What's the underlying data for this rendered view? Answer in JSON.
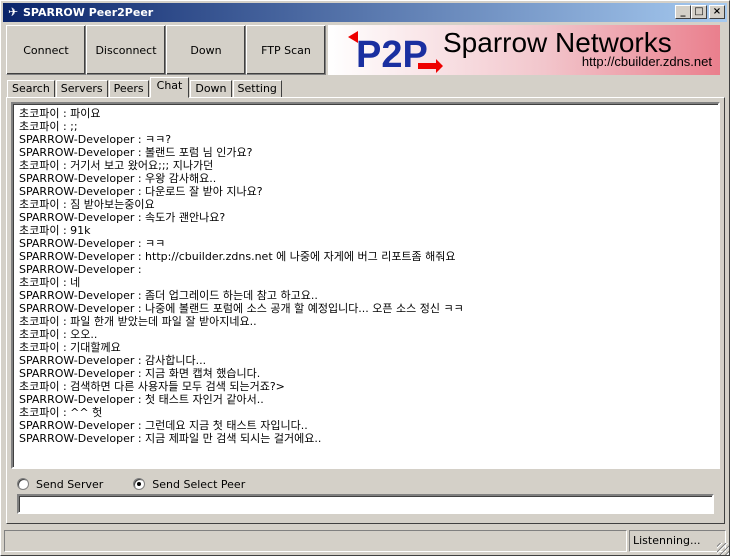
{
  "window": {
    "title": "SPARROW Peer2Peer",
    "min_label": "_",
    "max_label": "□",
    "close_label": "×"
  },
  "toolbar": {
    "connect": "Connect",
    "disconnect": "Disconnect",
    "down": "Down",
    "ftp_scan": "FTP Scan"
  },
  "banner": {
    "logo_text": "P2P",
    "title": "Sparrow Networks",
    "url": "http://cbuilder.zdns.net"
  },
  "tabs": [
    "Search",
    "Servers",
    "Peers",
    "Chat",
    "Down",
    "Setting"
  ],
  "active_tab": "Chat",
  "chat": [
    "초코파이 : 파이요",
    "초코파이 : ;;",
    "SPARROW-Developer : ㅋㅋ?",
    "SPARROW-Developer : 볼랜드 포럼 님 인가요?",
    "초코파이 : 거기서 보고 왔어요;;; 지나가던",
    "SPARROW-Developer : 우왕 감사해요..",
    "SPARROW-Developer : 다운로드 잘 받아 지나요?",
    "초코파이 : 짐 받아보는중이요",
    "SPARROW-Developer : 속도가 괜안나요?",
    "초코파이 : 91k",
    "SPARROW-Developer : ㅋㅋ",
    "SPARROW-Developer : http://cbuilder.zdns.net 에 나중에 자게에 버그 리포트좀 해줘요",
    "SPARROW-Developer :",
    "초코파이 : 네",
    "SPARROW-Developer : 좀더 업그레이드 하는데 참고 하고요..",
    "SPARROW-Developer : 나중에 볼랜드 포럼에 소스 공개 할 예정입니다... 오픈 소스 정신 ㅋㅋ",
    "초코파이 : 파일 한개 받았는데 파일 잘 받아지네요..",
    "초코파이 : 오오..",
    "초코파이 : 기대할께요",
    "SPARROW-Developer : 감사합니다...",
    "SPARROW-Developer : 지금 화면 캡쳐 했습니다.",
    "초코파이 : 검색하면 다른 사용자들 모두 검색 되는거죠?>",
    "SPARROW-Developer : 첫 태스트 자인거 같아서..",
    "초코파이 : ^^ 헛",
    "SPARROW-Developer : 그런데요 지금 첫 태스트 자입니다..",
    "SPARROW-Developer : 지금 제파일 만 검색 되시는 걸거에요.."
  ],
  "send": {
    "server_label": "Send Server",
    "peer_label": "Send Select Peer",
    "selected": "peer",
    "message_value": ""
  },
  "status": {
    "text": "Listenning..."
  }
}
